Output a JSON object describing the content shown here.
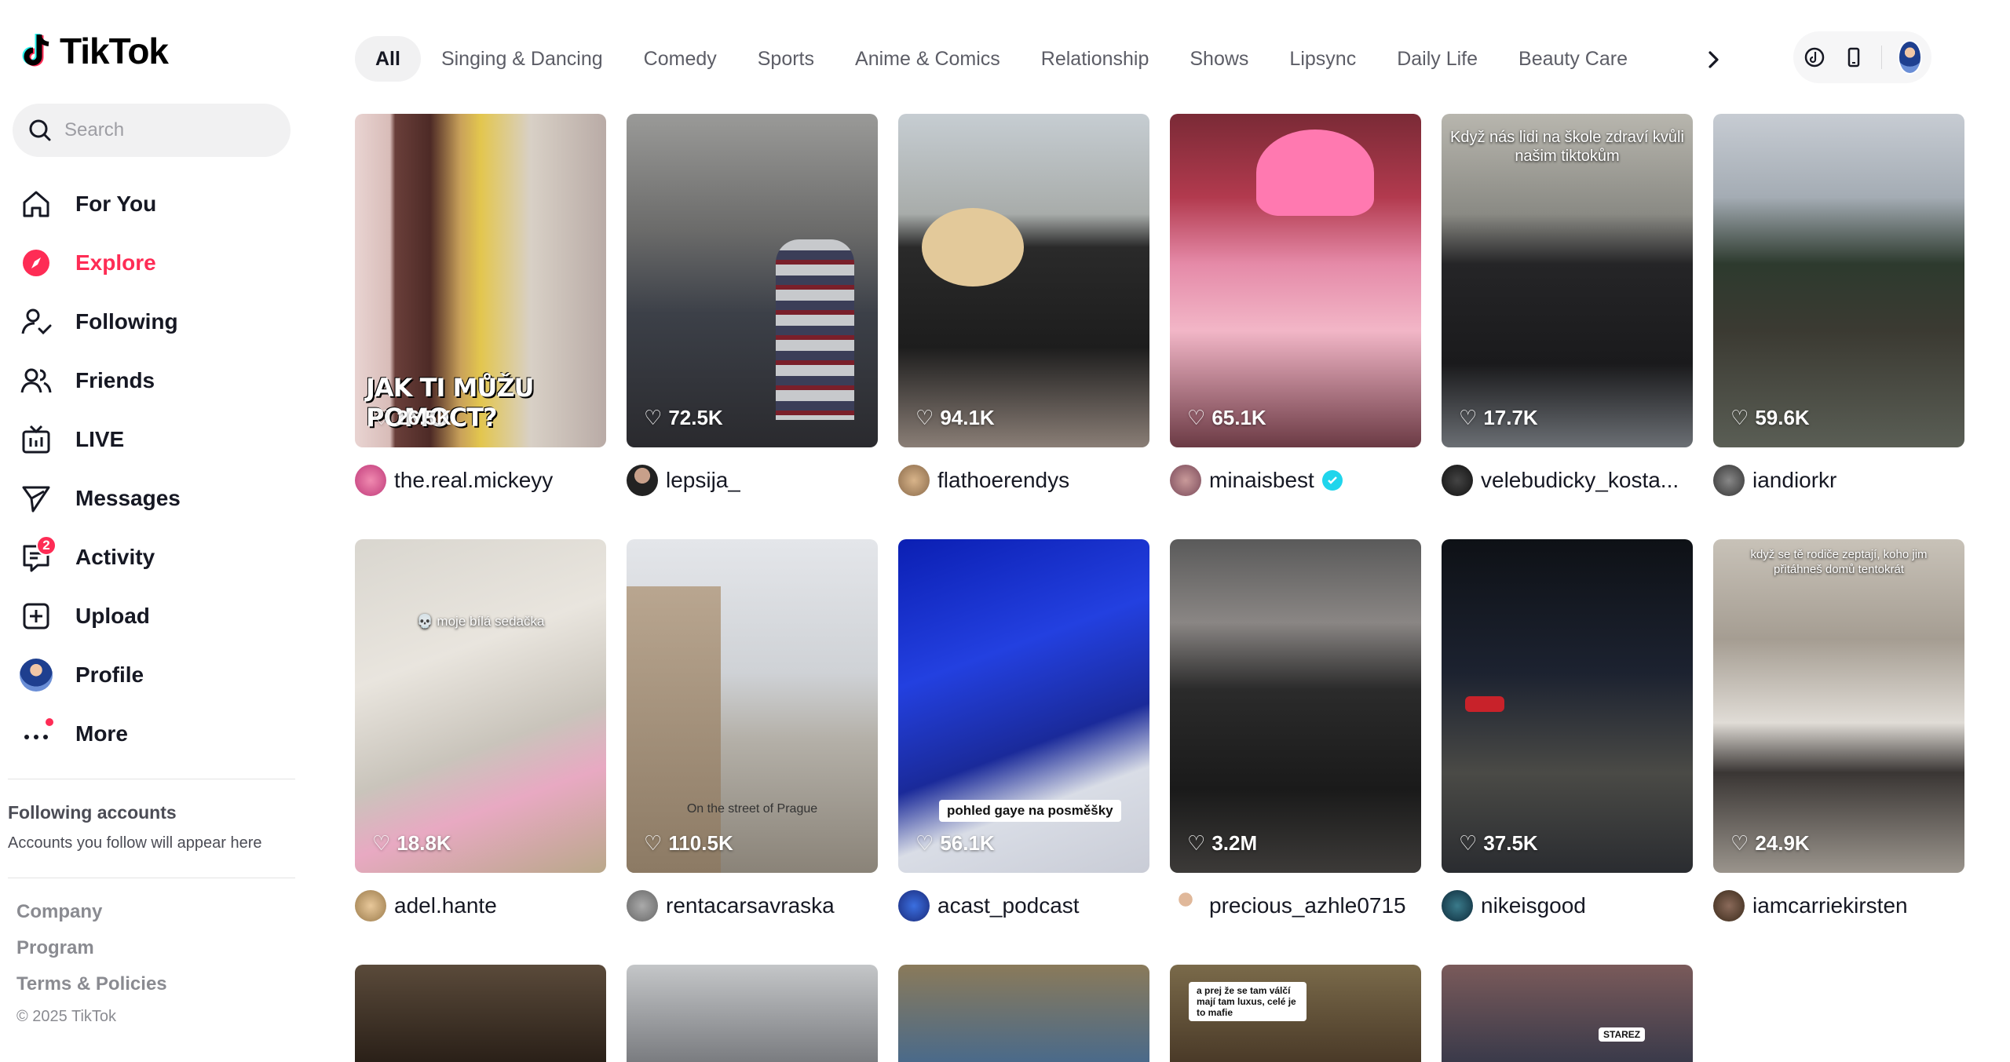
{
  "brand": {
    "name": "TikTok",
    "accent": "#fe2c55"
  },
  "search": {
    "placeholder": "Search"
  },
  "nav": [
    {
      "label": "For You",
      "icon": "home-icon"
    },
    {
      "label": "Explore",
      "icon": "compass-icon",
      "active": true
    },
    {
      "label": "Following",
      "icon": "following-icon"
    },
    {
      "label": "Friends",
      "icon": "friends-icon"
    },
    {
      "label": "LIVE",
      "icon": "live-icon"
    },
    {
      "label": "Messages",
      "icon": "messages-icon"
    },
    {
      "label": "Activity",
      "icon": "activity-icon",
      "badge": "2"
    },
    {
      "label": "Upload",
      "icon": "upload-icon"
    },
    {
      "label": "Profile",
      "icon": "profile-avatar"
    },
    {
      "label": "More",
      "icon": "more-icon"
    }
  ],
  "following_accounts": {
    "title": "Following accounts",
    "subtitle": "Accounts you follow will appear here"
  },
  "footer": {
    "links": [
      "Company",
      "Program",
      "Terms & Policies"
    ],
    "copyright": "© 2025 TikTok"
  },
  "categories": [
    "All",
    "Singing & Dancing",
    "Comedy",
    "Sports",
    "Anime & Comics",
    "Relationship",
    "Shows",
    "Lipsync",
    "Daily Life",
    "Beauty Care"
  ],
  "videos": [
    {
      "likes": "26.5K",
      "author": "the.real.mickeyy",
      "overlay": "JAK TI MŮŽU POMOCT?"
    },
    {
      "likes": "72.5K",
      "author": "lepsija_"
    },
    {
      "likes": "94.1K",
      "author": "flathoerendys"
    },
    {
      "likes": "65.1K",
      "author": "minaisbest",
      "verified": true
    },
    {
      "likes": "17.7K",
      "author": "velebudicky_kosta...",
      "overlay": "Když nás lidi na škole zdraví kvůli našim tiktokům"
    },
    {
      "likes": "59.6K",
      "author": "iandiorkr"
    },
    {
      "likes": "18.8K",
      "author": "adel.hante",
      "overlay": "💀 moje bílá sedačka"
    },
    {
      "likes": "110.5K",
      "author": "rentacarsavraska",
      "overlay": "On the street of Prague"
    },
    {
      "likes": "56.1K",
      "author": "acast_podcast",
      "overlay": "pohled gaye na posměšky"
    },
    {
      "likes": "3.2M",
      "author": "precious_azhle0715"
    },
    {
      "likes": "37.5K",
      "author": "nikeisgood"
    },
    {
      "likes": "24.9K",
      "author": "iamcarriekirsten",
      "overlay": "když se tě rodiče zeptají, koho jim přitáhneš domů tentokrát"
    }
  ],
  "partial_row": [
    {
      "overlay": ""
    },
    {
      "overlay": ""
    },
    {
      "overlay": ""
    },
    {
      "overlay": "a prej že se tam válčí mají tam luxus, celé je to mafie"
    },
    {
      "overlay": "STAREZ"
    }
  ]
}
